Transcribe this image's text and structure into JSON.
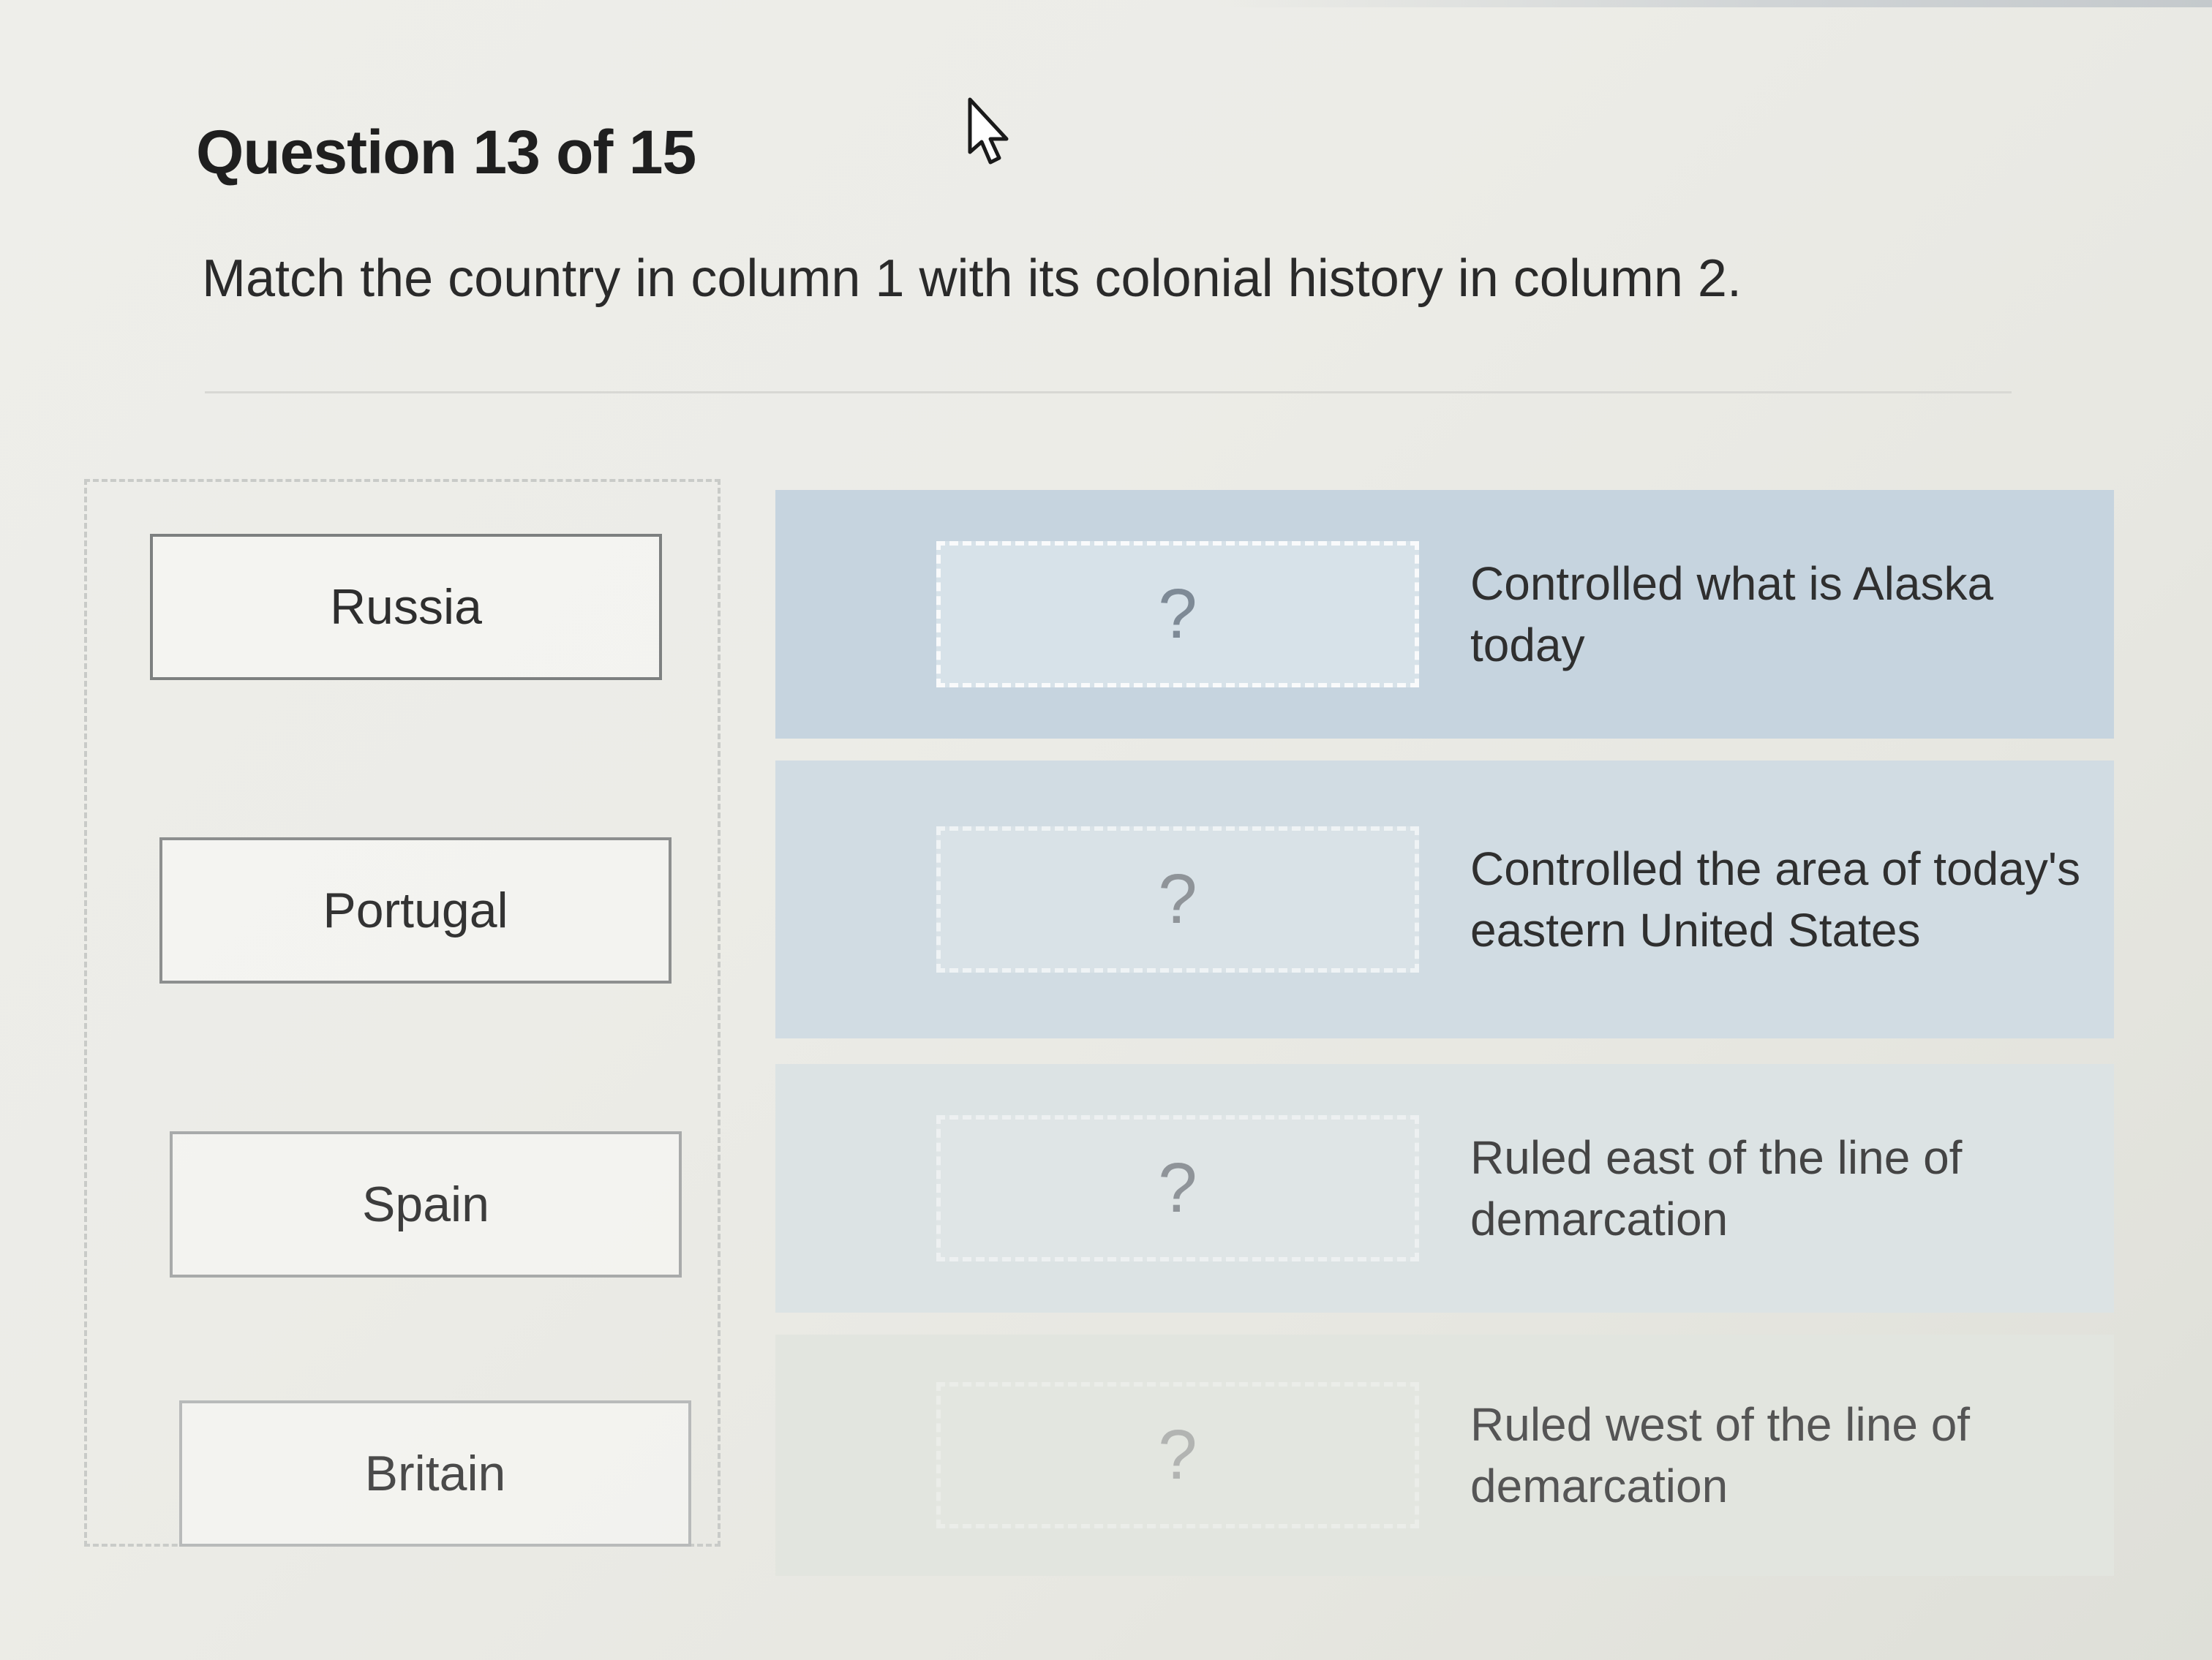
{
  "question": {
    "title": "Question 13 of 15",
    "prompt": "Match the country in column 1 with its colonial history in column 2."
  },
  "column1": {
    "choices": [
      "Russia",
      "Portugal",
      "Spain",
      "Britain"
    ]
  },
  "column2": {
    "placeholder": "?",
    "items": [
      "Controlled what is Alaska today",
      "Controlled the area of today's eastern United States",
      "Ruled east of the line of demarcation",
      "Ruled west of the line of demarcation"
    ]
  },
  "icons": {
    "cursor": "mouse-pointer-icon"
  }
}
